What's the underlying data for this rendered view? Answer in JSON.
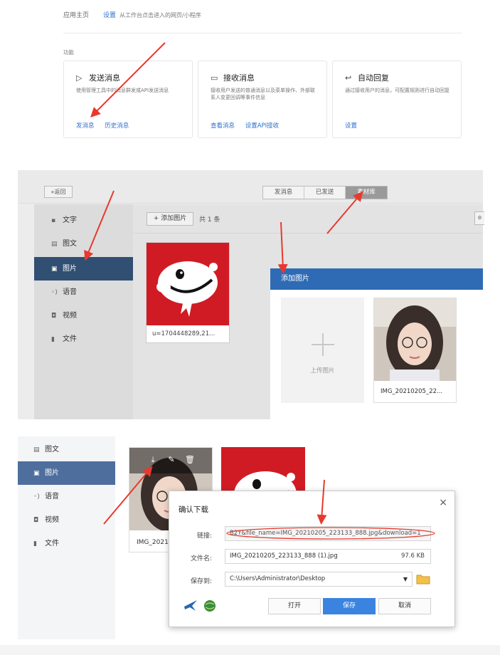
{
  "panel1": {
    "breadcrumb": {
      "home": "应用主页",
      "current": "设置",
      "desc": "从工作台点击进入的网页/小程序"
    },
    "section_label": "功能",
    "cards": [
      {
        "icon": "send-icon",
        "title": "发送消息",
        "desc": "使用管理工具中的消息群发或API发送消息",
        "links": [
          "发消息",
          "历史消息"
        ]
      },
      {
        "icon": "chat-icon",
        "title": "接收消息",
        "desc": "接收用户发送的普通消息以及菜单操作、外部联系人变更回调等事件信息",
        "links": [
          "查看消息",
          "设置API接收"
        ]
      },
      {
        "icon": "reply-icon",
        "title": "自动回复",
        "desc": "通过接收用户的消息，可配置规则进行自动回复",
        "links": [
          "设置"
        ]
      }
    ]
  },
  "panel2": {
    "back": "«返回",
    "segments": [
      "发消息",
      "已发送",
      "素材库"
    ],
    "active_segment": 2,
    "sidebar": [
      {
        "icon": "text-icon",
        "label": "文字"
      },
      {
        "icon": "image-text-icon",
        "label": "图文"
      },
      {
        "icon": "image-icon",
        "label": "图片"
      },
      {
        "icon": "voice-icon",
        "label": "语音"
      },
      {
        "icon": "video-icon",
        "label": "视频"
      },
      {
        "icon": "file-icon",
        "label": "文件"
      }
    ],
    "add_button": "+ 添加图片",
    "count": "共 1 条",
    "thumb_caption": "u=1704448289,21...",
    "dialog": {
      "title": "添加图片",
      "upload_label": "上传图片",
      "photo_caption": "IMG_20210205_22..."
    }
  },
  "panel3": {
    "sidebar": [
      {
        "icon": "image-text-icon",
        "label": "图文"
      },
      {
        "icon": "image-icon",
        "label": "图片"
      },
      {
        "icon": "voice-icon",
        "label": "语音"
      },
      {
        "icon": "video-icon",
        "label": "视频"
      },
      {
        "icon": "file-icon",
        "label": "文件"
      }
    ],
    "photo_caption": "IMG_2021",
    "download_dialog": {
      "title": "确认下载",
      "link_label": "链接:",
      "link_value": "B2Y&file_name=IMG_20210205_223133_888.jpg&download=1",
      "filename_label": "文件名:",
      "filename_value": "IMG_20210205_223133_888 (1).jpg",
      "file_size": "97.6 KB",
      "saveto_label": "保存到:",
      "saveto_value": "C:\\Users\\Administrator\\Desktop",
      "buttons": {
        "open": "打开",
        "save": "保存",
        "cancel": "取消"
      }
    }
  },
  "colors": {
    "link_blue": "#2d6fd0",
    "nav_active": "#304f72",
    "dialog_header": "#2f6bb5",
    "primary_button": "#3a84e0",
    "annotation_red": "#e8392e",
    "jd_red": "#d11b24"
  }
}
